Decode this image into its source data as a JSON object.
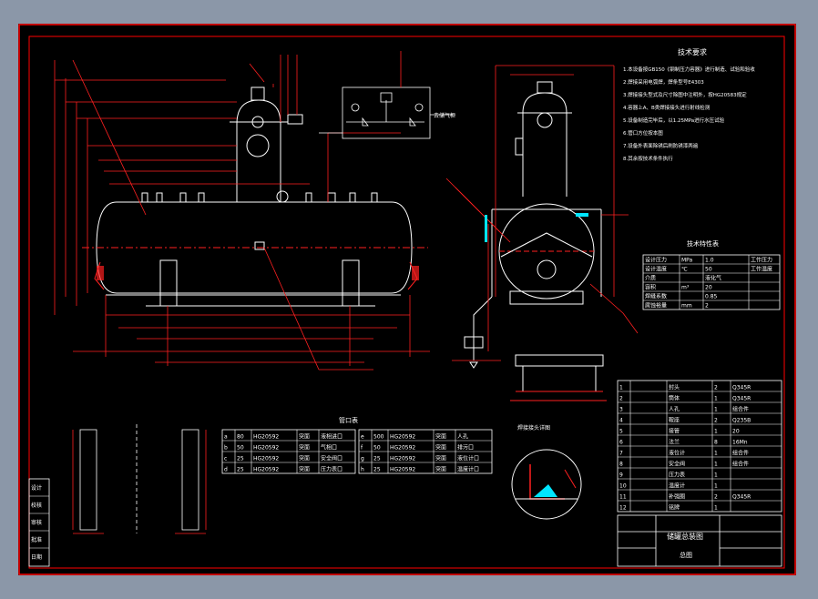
{
  "colors": {
    "background": "#8b97a8",
    "sheet": "#000000",
    "frame": "#ff0000",
    "line": "#ffffff",
    "dim": "#ff2020",
    "accent": "#00e5ff"
  },
  "drawing": {
    "tech_req_title": "技术要求",
    "spec_table_title": "技术特性表",
    "nozzle_table_title": "管口表",
    "title_block_name": "储罐总装图",
    "title_block_sub": "总图",
    "weld_detail_title": "焊接接头详图",
    "valve_label": "去储气柜"
  },
  "tech_requirements": [
    "1.本设备按GB150《钢制压力容器》进行制造、试验和验收",
    "2.焊接采用电弧焊，焊条型号E4303",
    "3.焊接接头型式及尺寸除图中注明外，按HG20583规定",
    "4.容器上A、B类焊接接头进行射线检测",
    "5.设备制造完毕后，以1.25MPa进行水压试验",
    "6.管口方位按本图",
    "7.设备外表面除锈后刷防锈漆两遍",
    "8.其余按技术条件执行"
  ],
  "spec_rows": [
    [
      "设计压力",
      "MPa",
      "1.0",
      "工作压力"
    ],
    [
      "设计温度",
      "℃",
      "50",
      "工作温度"
    ],
    [
      "介质",
      "",
      "液化气",
      ""
    ],
    [
      "容积",
      "m³",
      "20",
      ""
    ],
    [
      "焊缝系数",
      "",
      "0.85",
      ""
    ],
    [
      "腐蚀裕量",
      "mm",
      "2",
      ""
    ]
  ],
  "nozzle_rows": [
    [
      "a",
      "80",
      "HG20592",
      "突面",
      "液相进口"
    ],
    [
      "b",
      "50",
      "HG20592",
      "突面",
      "气相口"
    ],
    [
      "c",
      "25",
      "HG20592",
      "突面",
      "安全阀口"
    ],
    [
      "d",
      "25",
      "HG20592",
      "突面",
      "压力表口"
    ],
    [
      "e",
      "500",
      "HG20592",
      "突面",
      "人孔"
    ],
    [
      "f",
      "50",
      "HG20592",
      "突面",
      "排污口"
    ],
    [
      "g",
      "25",
      "HG20592",
      "突面",
      "液位计口"
    ],
    [
      "h",
      "25",
      "HG20592",
      "突面",
      "温度计口"
    ]
  ],
  "bom_rows": [
    [
      "1",
      "",
      "封头",
      "2",
      "Q345R"
    ],
    [
      "2",
      "",
      "筒体",
      "1",
      "Q345R"
    ],
    [
      "3",
      "",
      "人孔",
      "1",
      "组合件"
    ],
    [
      "4",
      "",
      "鞍座",
      "2",
      "Q235B"
    ],
    [
      "5",
      "",
      "接管",
      "1",
      "20"
    ],
    [
      "6",
      "",
      "法兰",
      "8",
      "16Mn"
    ],
    [
      "7",
      "",
      "液位计",
      "1",
      "组合件"
    ],
    [
      "8",
      "",
      "安全阀",
      "1",
      "组合件"
    ],
    [
      "9",
      "",
      "压力表",
      "1",
      ""
    ],
    [
      "10",
      "",
      "温度计",
      "1",
      ""
    ],
    [
      "11",
      "",
      "补强圈",
      "2",
      "Q345R"
    ],
    [
      "12",
      "",
      "铭牌",
      "1",
      ""
    ]
  ],
  "left_block": [
    "设计",
    "校核",
    "审核",
    "批准",
    "日期"
  ]
}
